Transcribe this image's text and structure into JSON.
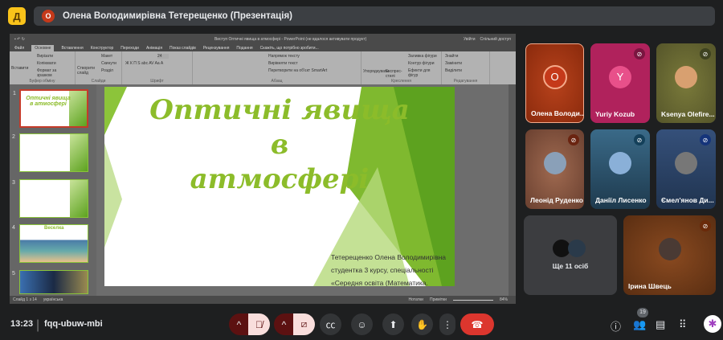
{
  "header": {
    "logo": "Д",
    "presenter_initial": "О",
    "title": "Олена Володимирівна Тетерещенко (Презентація)"
  },
  "ppt": {
    "window_title": "Виступ Оптичні явища в атмосфері - PowerPoint (не вдалося активувати продукт)",
    "sign_in": "Увійти",
    "share": "Спільний доступ",
    "tabs": [
      "Файл",
      "Основне",
      "Вставлення",
      "Конструктор",
      "Переходи",
      "Анімація",
      "Показ слайдів",
      "Рецензування",
      "Подання"
    ],
    "tell_me": "Скажіть, що потрібно зробити...",
    "groups": {
      "clipboard": {
        "label": "Буфер обміну",
        "paste": "Вставити",
        "cut": "Вирізати",
        "copy": "Копіювати",
        "format": "Формат за зразком"
      },
      "slides": {
        "label": "Слайди",
        "new": "Створити слайд",
        "layout": "Макет",
        "reset": "Скинути",
        "section": "Розділ"
      },
      "font": {
        "label": "Шрифт",
        "size": "24"
      },
      "paragraph": {
        "label": "Абзац",
        "dir": "Напрямок тексту",
        "align": "Вирівняти текст",
        "smartart": "Перетворити на об'єкт SmartArt"
      },
      "drawing": {
        "label": "Креслення",
        "arrange": "Упорядкувати",
        "styles": "Експрес-стилі",
        "fill": "Заливка фігури",
        "outline": "Контур фігури",
        "effects": "Ефекти для фігур"
      },
      "editing": {
        "label": "Редагування",
        "find": "Знайти",
        "replace": "Замінити",
        "select": "Виділити"
      }
    },
    "slide": {
      "title_lines": [
        "Оптичні явища",
        "в",
        "атмосфері"
      ],
      "subtitle_lines": [
        "Тетерещенко Олена Володимирівна",
        "студентка 3 курсу, спеціальності",
        "«Середня освіта (Математика. Фізика)»"
      ]
    },
    "thumbnails": [
      {
        "n": "1",
        "t": "Оптичні явища в атмосфері"
      },
      {
        "n": "2",
        "t": ""
      },
      {
        "n": "3",
        "t": ""
      },
      {
        "n": "4",
        "t": "Веселка"
      },
      {
        "n": "5",
        "t": ""
      }
    ],
    "status": {
      "slide": "Слайд 1 з 14",
      "lang": "українська",
      "notes": "Нотатки",
      "comments": "Примітки",
      "zoom": "84%"
    }
  },
  "participants": [
    {
      "name": "Олена Володи...",
      "initial": "О",
      "color": "#a8300f",
      "muted": false
    },
    {
      "name": "Yuriy Kozub",
      "initial": "Y",
      "color": "#b0225c",
      "muted": true
    },
    {
      "name": "Ksenya Olefire...",
      "initial": "",
      "color": "#6b6a34",
      "muted": true
    },
    {
      "name": "Леонід Руденко",
      "initial": "",
      "color": "#8a5a44",
      "muted": true
    },
    {
      "name": "Даніїл Лисенко",
      "initial": "",
      "color": "#2e5670",
      "muted": true
    },
    {
      "name": "Ємел'янов Ди...",
      "initial": "",
      "color": "#2d4870",
      "muted": true
    },
    {
      "name": "Ірина Швець",
      "initial": "",
      "color": "#7a3e18",
      "muted": true
    }
  ],
  "more": {
    "label": "Ще 11 осіб"
  },
  "bottom": {
    "time": "13:23",
    "meeting_code": "fqq-ubuw-mbi",
    "people_count": "19"
  }
}
